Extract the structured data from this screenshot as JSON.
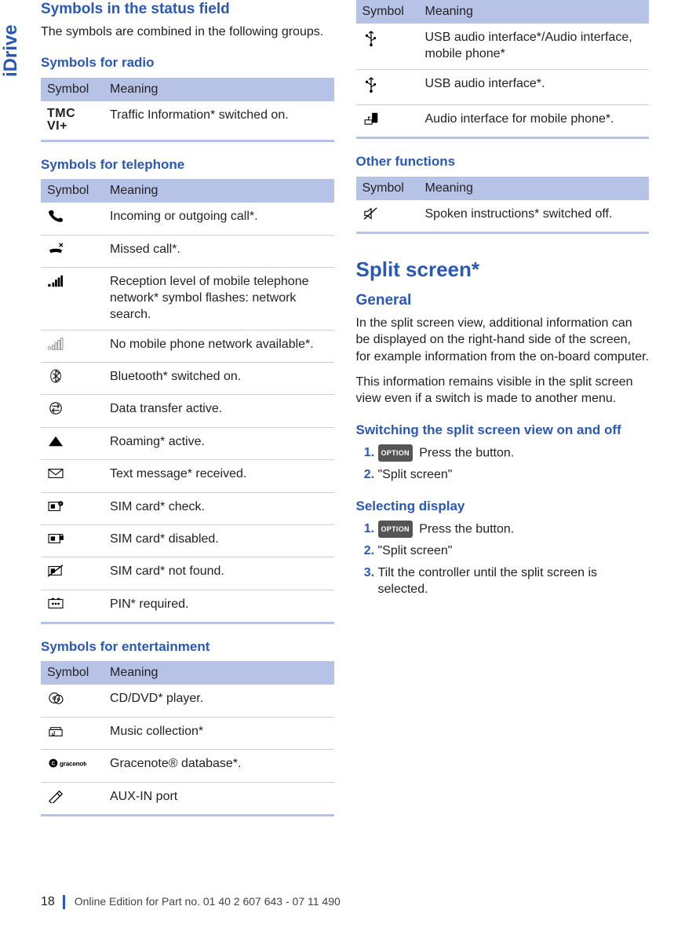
{
  "side_tab": "iDrive",
  "left": {
    "h_status": "Symbols in the status field",
    "p_status": "The symbols are combined in the following groups.",
    "h_radio": "Symbols for radio",
    "radio": {
      "th_symbol": "Symbol",
      "th_meaning": "Meaning",
      "r0_sym_a": "TMC",
      "r0_sym_b": "VI+",
      "r0_meaning": "Traffic Information* switched on."
    },
    "h_tel": "Symbols for telephone",
    "tel": {
      "th_symbol": "Symbol",
      "th_meaning": "Meaning",
      "r0": "Incoming or outgoing call*.",
      "r1": "Missed call*.",
      "r2": "Reception level of mobile telephone network* symbol flashes: network search.",
      "r3": "No mobile phone network available*.",
      "r4": "Bluetooth* switched on.",
      "r5": "Data transfer active.",
      "r6": "Roaming* active.",
      "r7": "Text message* received.",
      "r8": "SIM card* check.",
      "r9": "SIM card* disabled.",
      "r10": "SIM card* not found.",
      "r11": "PIN* required."
    },
    "h_ent": "Symbols for entertainment",
    "ent": {
      "th_symbol": "Symbol",
      "th_meaning": "Meaning",
      "r0": "CD/DVD* player.",
      "r1": "Music collection*",
      "r2": "Gracenote® database*.",
      "r3": "AUX-IN port"
    }
  },
  "right": {
    "ent2": {
      "th_symbol": "Symbol",
      "th_meaning": "Meaning",
      "r0": "USB audio interface*/Audio interface, mobile phone*",
      "r1": "USB audio interface*.",
      "r2": "Audio interface for mobile phone*."
    },
    "h_other": "Other functions",
    "other": {
      "th_symbol": "Symbol",
      "th_meaning": "Meaning",
      "r0": "Spoken instructions* switched off."
    },
    "h_split": "Split screen*",
    "h_general": "General",
    "p_general_1": "In the split screen view, additional information can be displayed on the right-hand side of the screen, for example information from the on-board computer.",
    "p_general_2": "This information remains visible in the split screen view even if a switch is made to another menu.",
    "h_switch": "Switching the split screen view on and off",
    "switch_steps": {
      "option_label": "OPTION",
      "s1": " Press the button.",
      "s2": "\"Split screen\""
    },
    "h_select": "Selecting display",
    "select_steps": {
      "option_label": "OPTION",
      "s1": " Press the button.",
      "s2": "\"Split screen\"",
      "s3": "Tilt the controller until the split screen is selected."
    }
  },
  "footer": {
    "page": "18",
    "edition": "Online Edition for Part no. 01 40 2 607 643 - 07 11 490"
  }
}
